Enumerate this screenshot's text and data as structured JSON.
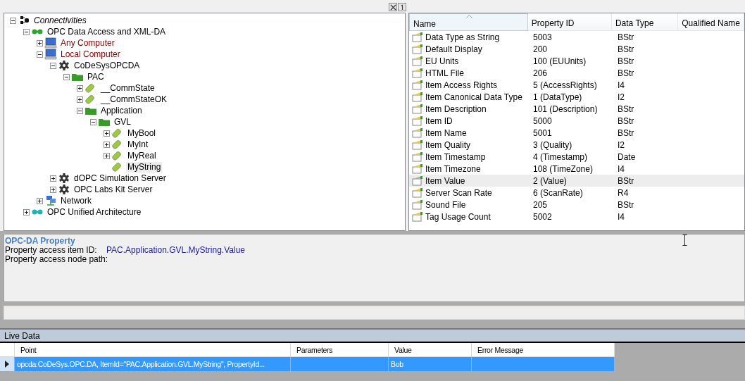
{
  "tree": [
    {
      "label": "Connectivities",
      "kind": "root",
      "expanded": true,
      "selected": false,
      "children": [
        {
          "label": "OPC Data Access and XML-DA",
          "kind": "connector",
          "expanded": true,
          "selected": false,
          "children": [
            {
              "label": "Any Computer",
              "kind": "computer",
              "color": "#800000",
              "expanded": false,
              "selected": false
            },
            {
              "label": "Local Computer",
              "kind": "computer",
              "color": "#800000",
              "expanded": true,
              "selected": false,
              "children": [
                {
                  "label": "CoDeSysOPCDA",
                  "kind": "server",
                  "expanded": true,
                  "selected": false,
                  "children": [
                    {
                      "label": "PAC",
                      "kind": "folder",
                      "expanded": true,
                      "selected": false,
                      "children": [
                        {
                          "label": "__CommState",
                          "kind": "tag",
                          "expanded": false,
                          "selected": false
                        },
                        {
                          "label": "__CommStateOK",
                          "kind": "tag",
                          "expanded": false,
                          "selected": false
                        },
                        {
                          "label": "Application",
                          "kind": "folder",
                          "expanded": true,
                          "selected": false,
                          "children": [
                            {
                              "label": "GVL",
                              "kind": "folder",
                              "expanded": true,
                              "selected": false,
                              "children": [
                                {
                                  "label": "MyBool",
                                  "kind": "tag",
                                  "expanded": false,
                                  "selected": false
                                },
                                {
                                  "label": "MyInt",
                                  "kind": "tag",
                                  "expanded": false,
                                  "selected": false
                                },
                                {
                                  "label": "MyReal",
                                  "kind": "tag",
                                  "expanded": false,
                                  "selected": false
                                },
                                {
                                  "label": "MyString",
                                  "kind": "tag",
                                  "selected": true
                                }
                              ]
                            }
                          ]
                        }
                      ]
                    }
                  ]
                },
                {
                  "label": "dOPC Simulation Server",
                  "kind": "server",
                  "expanded": false,
                  "selected": false
                },
                {
                  "label": "OPC Labs Kit Server",
                  "kind": "server",
                  "expanded": false,
                  "selected": false
                }
              ]
            },
            {
              "label": "Network",
              "kind": "network",
              "expanded": false,
              "selected": false
            }
          ]
        },
        {
          "label": "OPC Unified Architecture",
          "kind": "connector-ua",
          "expanded": false,
          "selected": false
        }
      ]
    }
  ],
  "properties": {
    "columns": [
      "Name",
      "Property ID",
      "Data Type",
      "Qualified Name"
    ],
    "rows": [
      {
        "name": "Data Type as String",
        "id": "5003",
        "type": "BStr",
        "selected": false
      },
      {
        "name": "Default Display",
        "id": "200",
        "type": "BStr",
        "selected": false
      },
      {
        "name": "EU Units",
        "id": "100 (EUUnits)",
        "type": "BStr",
        "selected": false
      },
      {
        "name": "HTML File",
        "id": "206",
        "type": "BStr",
        "selected": false
      },
      {
        "name": "Item Access Rights",
        "id": "5 (AccessRights)",
        "type": "I4",
        "selected": false
      },
      {
        "name": "Item Canonical Data Type",
        "id": "1 (DataType)",
        "type": "I2",
        "selected": false
      },
      {
        "name": "Item Description",
        "id": "101 (Description)",
        "type": "BStr",
        "selected": false
      },
      {
        "name": "Item ID",
        "id": "5000",
        "type": "BStr",
        "selected": false
      },
      {
        "name": "Item Name",
        "id": "5001",
        "type": "BStr",
        "selected": false
      },
      {
        "name": "Item Quality",
        "id": "3 (Quality)",
        "type": "I2",
        "selected": false
      },
      {
        "name": "Item Timestamp",
        "id": "4 (Timestamp)",
        "type": "Date",
        "selected": false
      },
      {
        "name": "Item Timezone",
        "id": "108 (TimeZone)",
        "type": "I4",
        "selected": false
      },
      {
        "name": "Item Value",
        "id": "2 (Value)",
        "type": "BStr",
        "selected": true
      },
      {
        "name": "Server Scan Rate",
        "id": "6 (ScanRate)",
        "type": "R4",
        "selected": false
      },
      {
        "name": "Sound File",
        "id": "205",
        "type": "BStr",
        "selected": false
      },
      {
        "name": "Tag Usage Count",
        "id": "5002",
        "type": "I4",
        "selected": false
      }
    ]
  },
  "details": {
    "title": "OPC-DA Property",
    "fields": [
      {
        "label": "Property access item ID:",
        "value": "PAC.Application.GVL.MyString.Value"
      },
      {
        "label": "Property access node path:"
      }
    ]
  },
  "live_data": {
    "title": "Live Data",
    "columns": [
      "Point",
      "Parameters",
      "Value",
      "Error Message"
    ],
    "rows": [
      {
        "point": "opcda:CoDeSys.OPC.DA, ItemId=\"PAC.Application.GVL.MyString\", PropertyId...",
        "value": "Bob",
        "selected": true
      }
    ]
  }
}
